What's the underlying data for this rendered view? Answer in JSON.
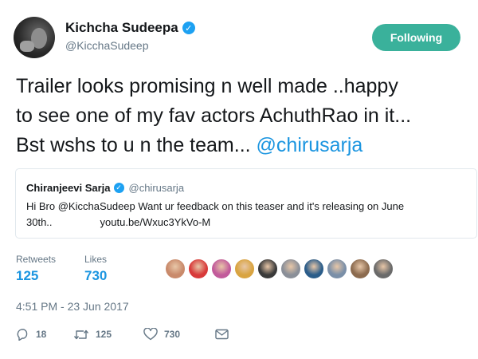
{
  "author": {
    "name": "Kichcha Sudeepa",
    "handle": "@KicchaSudeep",
    "verified": true
  },
  "follow_button": {
    "label": "Following",
    "color": "#3ab19b"
  },
  "tweet": {
    "lines": [
      "Trailer looks promising n well made ..happy",
      "to see one of my fav actors AchuthRao in it...",
      "Bst wshs to u n the team... "
    ],
    "mention": "@chirusarja"
  },
  "quoted_tweet": {
    "name": "Chiranjeevi Sarja",
    "handle": "@chirusarja",
    "text_line1": "Hi Bro @KicchaSudeep Want ur feedback on this teaser and it's releasing on June",
    "text_line2": "30th..",
    "link": "youtu.be/Wxuc3YkVo-M"
  },
  "stats": {
    "retweets_label": "Retweets",
    "retweets": "125",
    "likes_label": "Likes",
    "likes": "730"
  },
  "likers_colors": [
    "#c98a6b",
    "#d83a3a",
    "#c25b9b",
    "#d9a441",
    "#3a3a3a",
    "#8a8f98",
    "#2b5d8a",
    "#7a8fa8",
    "#8c6b4f",
    "#6a6a6a"
  ],
  "timestamp": "4:51 PM - 23 Jun 2017",
  "actions": {
    "reply_icon": "reply-icon",
    "replies": "18",
    "retweet_icon": "retweet-icon",
    "retweets": "125",
    "like_icon": "heart-icon",
    "likes": "730",
    "dm_icon": "envelope-icon"
  }
}
